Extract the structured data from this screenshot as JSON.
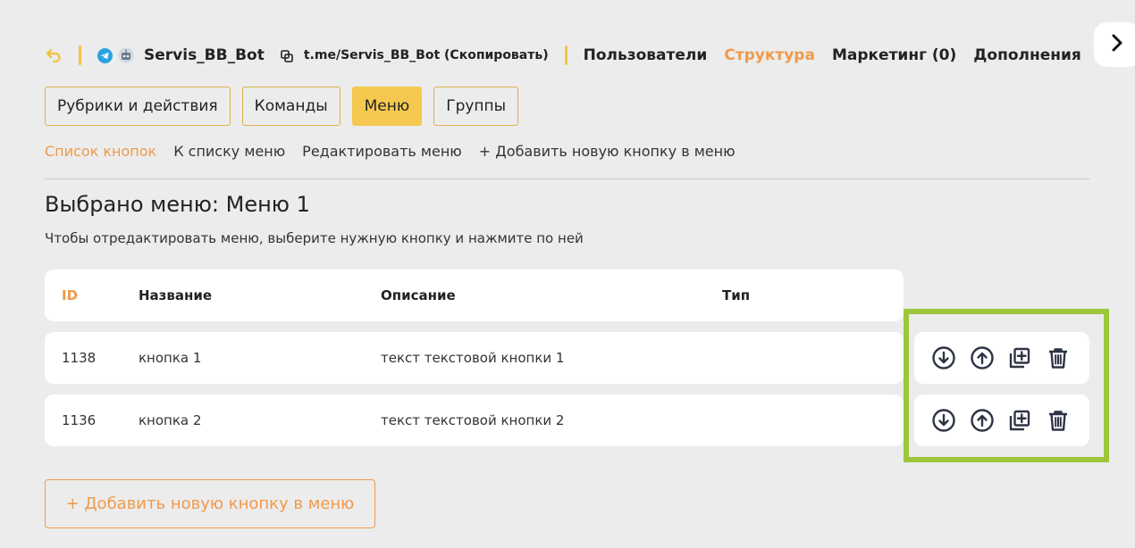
{
  "header": {
    "bot_name": "Servis_BB_Bot",
    "bot_link": "t.me/Servis_BB_Bot (Скопировать)",
    "nav": [
      "Пользователи",
      "Структура",
      "Маркетинг (0)",
      "Дополнения"
    ],
    "active_nav": "Структура"
  },
  "tabs": [
    "Рубрики и действия",
    "Команды",
    "Меню",
    "Группы"
  ],
  "active_tab": "Меню",
  "subnav": [
    "Список кнопок",
    "К списку меню",
    "Редактировать меню",
    "+ Добавить новую кнопку в меню"
  ],
  "active_subnav": "Список кнопок",
  "page": {
    "title": "Выбрано меню: Меню 1",
    "hint": "Чтобы отредактировать меню, выберите нужную кнопку и нажмите по ней"
  },
  "table": {
    "columns": [
      "ID",
      "Название",
      "Описание",
      "Тип"
    ],
    "rows": [
      {
        "id": "1138",
        "name": "кнопка 1",
        "description": "текст текстовой кнопки 1",
        "type": ""
      },
      {
        "id": "1136",
        "name": "кнопка 2",
        "description": "текст текстовой кнопки 2",
        "type": ""
      }
    ]
  },
  "row_actions": [
    "arrow-down-circle-icon",
    "arrow-up-circle-icon",
    "duplicate-icon",
    "trash-icon"
  ],
  "add_button_label": "+ Добавить новую кнопку в меню",
  "colors": {
    "accent_orange": "#ef9a4a",
    "accent_yellow": "#f5c94f",
    "highlight_green": "#9dc63b",
    "icon_dark": "#2e3445"
  }
}
